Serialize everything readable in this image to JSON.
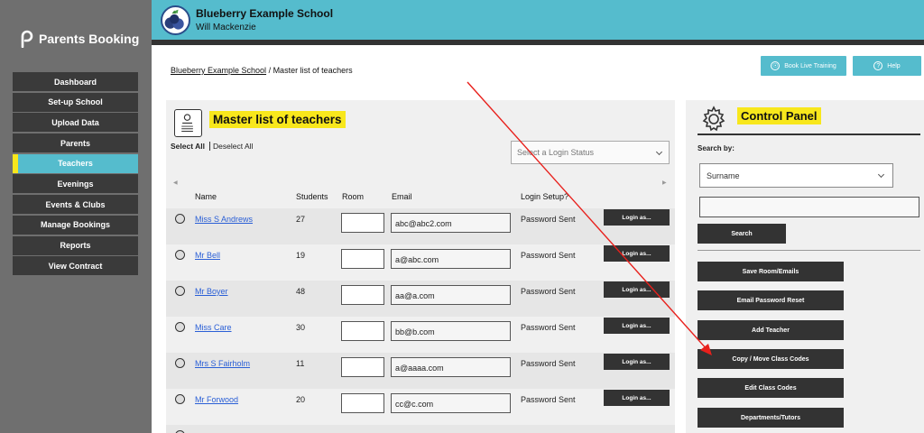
{
  "brand": {
    "name": "Parents Booking"
  },
  "sidebar": {
    "items": [
      {
        "label": "Dashboard",
        "active": false
      },
      {
        "label": "Set-up School",
        "active": false
      },
      {
        "label": "Upload Data",
        "active": false
      },
      {
        "label": "Parents",
        "active": false
      },
      {
        "label": "Teachers",
        "active": true
      },
      {
        "label": "Evenings",
        "active": false
      },
      {
        "label": "Events & Clubs",
        "active": false
      },
      {
        "label": "Manage Bookings",
        "active": false
      },
      {
        "label": "Reports",
        "active": false
      },
      {
        "label": "View Contract",
        "active": false
      }
    ]
  },
  "header": {
    "school": "Blueberry Example School",
    "user": "Will Mackenzie"
  },
  "breadcrumb": {
    "root": "Blueberry Example School",
    "current": " / Master list of teachers"
  },
  "top_buttons": {
    "training": "Book Live Training",
    "help": "Help"
  },
  "main": {
    "title": "Master list of teachers",
    "select_all": "Select All",
    "deselect_all": "Deselect All",
    "login_status_placeholder": "Select a Login Status",
    "columns": {
      "name": "Name",
      "students": "Students",
      "room": "Room",
      "email": "Email",
      "login": "Login Setup?"
    },
    "rows": [
      {
        "name": "Miss S Andrews",
        "students": "27",
        "email": "abc@abc2.com",
        "status": "Password Sent",
        "action": "Login as..."
      },
      {
        "name": "Mr Bell",
        "students": "19",
        "email": "a@abc.com",
        "status": "Password Sent",
        "action": "Login as..."
      },
      {
        "name": "Mr Boyer",
        "students": "48",
        "email": "aa@a.com",
        "status": "Password Sent",
        "action": "Login as..."
      },
      {
        "name": "Miss Care",
        "students": "30",
        "email": "bb@b.com",
        "status": "Password Sent",
        "action": "Login as..."
      },
      {
        "name": "Mrs S Fairholm",
        "students": "11",
        "email": "a@aaaa.com",
        "status": "Password Sent",
        "action": "Login as..."
      },
      {
        "name": "Mr Forwood",
        "students": "20",
        "email": "cc@c.com",
        "status": "Password Sent",
        "action": "Login as..."
      }
    ]
  },
  "control_panel": {
    "title": "Control Panel",
    "search_by": "Search by:",
    "search_field": "Surname",
    "search_button": "Search",
    "buttons": [
      "Save Room/Emails",
      "Email Password Reset",
      "Add Teacher",
      "Copy / Move Class Codes",
      "Edit Class Codes",
      "Departments/Tutors"
    ]
  },
  "colors": {
    "accent": "#55bccd",
    "highlight": "#f8e71c",
    "dark": "#333333",
    "sidebar": "#6f6f6f",
    "link": "#2a5fd6",
    "arrow": "#e8201c"
  },
  "icons": {
    "brand": "parents-booking-logo",
    "training": "headset-icon",
    "help": "question-icon",
    "panel": "teacher-list-icon",
    "control": "gear-icon"
  }
}
